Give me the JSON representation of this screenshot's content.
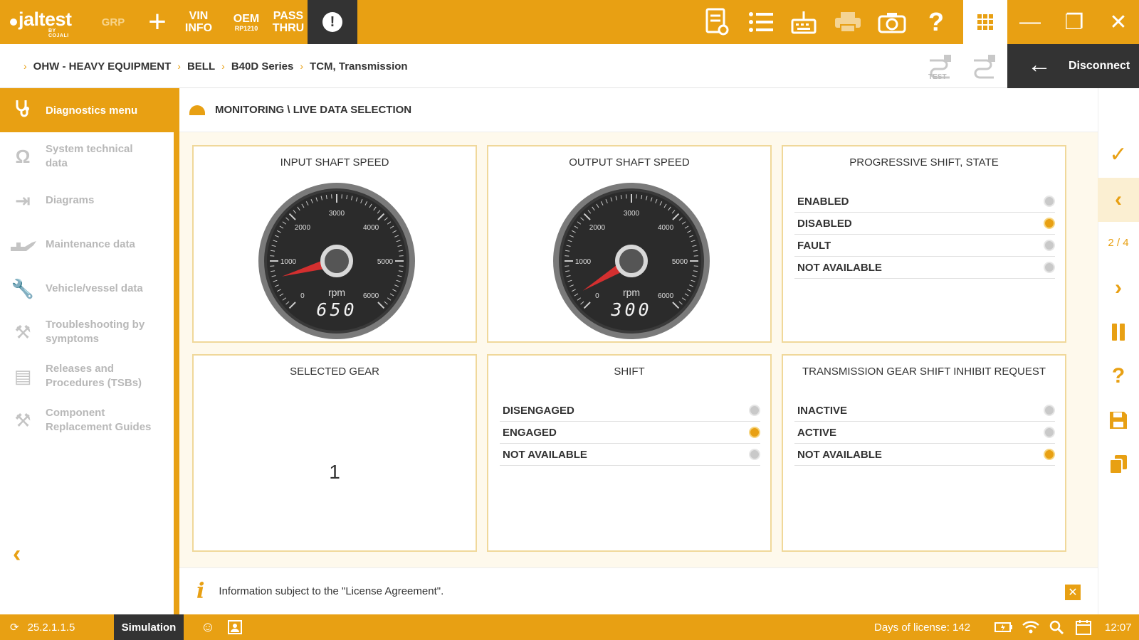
{
  "topbar": {
    "logo": "jaltest",
    "logo_sub": "BY COJALI",
    "grp": "GRP",
    "add": "+",
    "vin": {
      "line1": "VIN",
      "line2": "INFO"
    },
    "oem": {
      "line1": "OEM",
      "line2": "RP1210"
    },
    "pass": {
      "line1": "PASS",
      "line2": "THRU"
    },
    "alert": "!",
    "minimize": "—",
    "restore": "❐",
    "close": "✕"
  },
  "breadcrumb": {
    "items": [
      "OHW - HEAVY EQUIPMENT",
      "BELL",
      "B40D Series",
      "TCM, Transmission"
    ],
    "test_label": "TEST",
    "disconnect": "Disconnect"
  },
  "sidebar": {
    "header": "Diagnostics menu",
    "items": [
      {
        "label": "System technical data",
        "icon": "omega-icon"
      },
      {
        "label": "Diagrams",
        "icon": "diagram-icon"
      },
      {
        "label": "Maintenance data",
        "icon": "oil-can-icon"
      },
      {
        "label": "Vehicle/vessel data",
        "icon": "wrench-icon"
      },
      {
        "label": "Troubleshooting by symptoms",
        "icon": "tools-icon"
      },
      {
        "label": "Releases and Procedures (TSBs)",
        "icon": "document-icon"
      },
      {
        "label": "Component Replacement Guides",
        "icon": "replace-tools-icon"
      }
    ],
    "back": "‹"
  },
  "content": {
    "title": "MONITORING \\ LIVE DATA SELECTION",
    "panels": {
      "input_shaft": {
        "title": "INPUT SHAFT SPEED",
        "unit": "rpm",
        "value": 650,
        "display": "650",
        "scale": [
          "0",
          "1000",
          "2000",
          "3000",
          "4000",
          "5000",
          "6000"
        ]
      },
      "output_shaft": {
        "title": "OUTPUT SHAFT SPEED",
        "unit": "rpm",
        "value": 300,
        "display": "300",
        "scale": [
          "0",
          "1000",
          "2000",
          "3000",
          "4000",
          "5000",
          "6000"
        ]
      },
      "progressive_shift": {
        "title": "PROGRESSIVE SHIFT, STATE",
        "options": [
          {
            "label": "ENABLED",
            "selected": false
          },
          {
            "label": "DISABLED",
            "selected": true
          },
          {
            "label": "FAULT",
            "selected": false
          },
          {
            "label": "NOT AVAILABLE",
            "selected": false
          }
        ]
      },
      "selected_gear": {
        "title": "SELECTED GEAR",
        "value": "1"
      },
      "shift": {
        "title": "SHIFT",
        "options": [
          {
            "label": "DISENGAGED",
            "selected": false
          },
          {
            "label": "ENGAGED",
            "selected": true
          },
          {
            "label": "NOT AVAILABLE",
            "selected": false
          }
        ]
      },
      "inhibit": {
        "title": "TRANSMISSION GEAR SHIFT INHIBIT REQUEST",
        "options": [
          {
            "label": "INACTIVE",
            "selected": false
          },
          {
            "label": "ACTIVE",
            "selected": false
          },
          {
            "label": "NOT AVAILABLE",
            "selected": true
          }
        ]
      }
    },
    "info": "Information subject to the \"License Agreement\"."
  },
  "right_toolbar": {
    "page": "2 / 4"
  },
  "status": {
    "version": "25.2.1.1.5",
    "mode": "Simulation",
    "license": "Days of license: 142",
    "time": "12:07"
  },
  "colors": {
    "accent": "#E8A013",
    "dark": "#333333",
    "needle": "#D32F2F"
  }
}
